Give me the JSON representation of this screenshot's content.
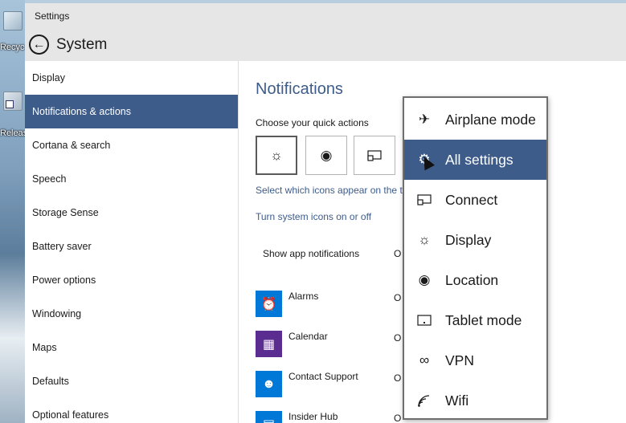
{
  "desktop": {
    "icon_labels": [
      "Recyc",
      "Releas"
    ]
  },
  "window": {
    "title": "Settings",
    "header_title": "System"
  },
  "sidebar": {
    "items": [
      {
        "label": "Display"
      },
      {
        "label": "Notifications & actions",
        "active": true
      },
      {
        "label": "Cortana & search"
      },
      {
        "label": "Speech"
      },
      {
        "label": "Storage Sense"
      },
      {
        "label": "Battery saver"
      },
      {
        "label": "Power options"
      },
      {
        "label": "Windowing"
      },
      {
        "label": "Maps"
      },
      {
        "label": "Defaults"
      },
      {
        "label": "Optional features"
      }
    ]
  },
  "main": {
    "section_title": "Notifications",
    "quick_actions_label": "Choose your quick actions",
    "quick_action_icons": [
      "brightness-icon",
      "location-icon",
      "connect-icon"
    ],
    "link_select_icons": "Select which icons appear on the t",
    "link_system_icons": "Turn system icons on or off",
    "show_app_notifications": "Show app notifications",
    "toggle_text": "O",
    "apps": [
      {
        "name": "Alarms",
        "icon": "alarm-clock-icon",
        "color": "#0078d7"
      },
      {
        "name": "Calendar",
        "icon": "calendar-icon",
        "color": "#5c2d91"
      },
      {
        "name": "Contact Support",
        "icon": "person-icon",
        "color": "#0078d7"
      },
      {
        "name": "Insider Hub",
        "icon": "insider-hub-icon",
        "color": "#0078d7"
      }
    ]
  },
  "flyout": {
    "items": [
      {
        "label": "Airplane mode",
        "icon": "airplane-icon"
      },
      {
        "label": "All settings",
        "icon": "gear-icon",
        "active": true
      },
      {
        "label": "Connect",
        "icon": "connect-icon"
      },
      {
        "label": "Display",
        "icon": "brightness-icon"
      },
      {
        "label": "Location",
        "icon": "location-icon"
      },
      {
        "label": "Tablet mode",
        "icon": "tablet-icon"
      },
      {
        "label": "VPN",
        "icon": "vpn-icon"
      },
      {
        "label": "Wifi",
        "icon": "wifi-icon"
      }
    ]
  },
  "colors": {
    "accent": "#3e5c8a",
    "chrome": "#e6e6e6"
  }
}
